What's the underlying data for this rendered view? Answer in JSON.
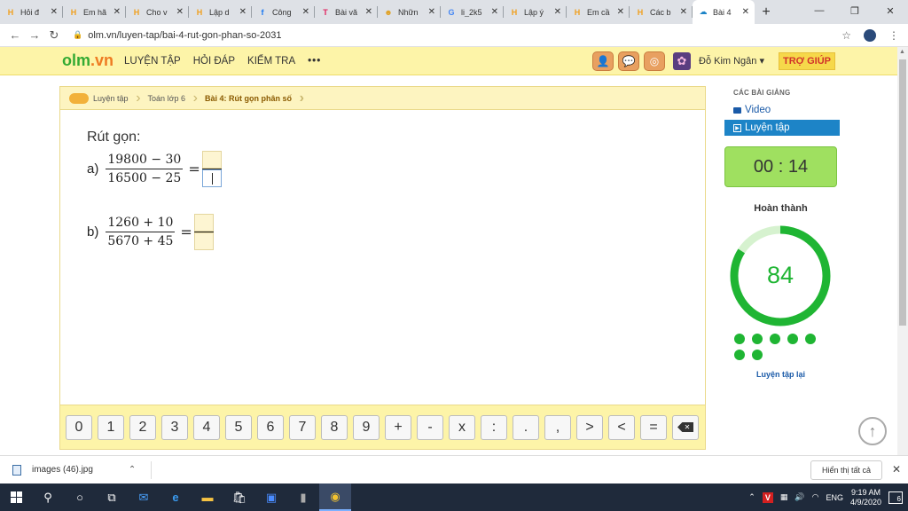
{
  "browser": {
    "tabs": [
      {
        "title": "Hỏi đ",
        "icon": "H",
        "color": "#f0a020"
      },
      {
        "title": "Em hã",
        "icon": "H",
        "color": "#f0a020"
      },
      {
        "title": "Cho v",
        "icon": "H",
        "color": "#f0a020"
      },
      {
        "title": "Lập d",
        "icon": "H",
        "color": "#f0a020"
      },
      {
        "title": "Công",
        "icon": "f",
        "color": "#1877f2"
      },
      {
        "title": "Bài vă",
        "icon": "T",
        "color": "#e0245e"
      },
      {
        "title": "Nhữn",
        "icon": "☻",
        "color": "#e0a020"
      },
      {
        "title": "li_2k5",
        "icon": "G",
        "color": "#4285f4"
      },
      {
        "title": "Lập ý",
        "icon": "H",
        "color": "#f0a020"
      },
      {
        "title": "Em cầ",
        "icon": "H",
        "color": "#f0a020"
      },
      {
        "title": "Các b",
        "icon": "H",
        "color": "#f0a020"
      },
      {
        "title": "Bài 4",
        "icon": "☁",
        "color": "#1d84c7",
        "active": true
      }
    ],
    "url": "olm.vn/luyen-tap/bai-4-rut-gon-phan-so-2031"
  },
  "header": {
    "logo_a": "olm",
    "logo_b": ".vn",
    "nav": [
      "LUYỆN TẬP",
      "HỎI ĐÁP",
      "KIỂM TRA"
    ],
    "more": "•••",
    "username": "Đỗ Kim Ngân",
    "help": "TRỢ GIÚP"
  },
  "breadcrumb": [
    "Luyện tập",
    "Toán lớp 6",
    "Bài 4: Rút gọn phân số"
  ],
  "question": {
    "title": "Rút gọn:",
    "a": {
      "label": "a)",
      "num": "19800 − 30",
      "den": "16500 − 25"
    },
    "b": {
      "label": "b)",
      "num": "1260 + 10",
      "den": "5670 + 45"
    },
    "eq": "="
  },
  "keypad": [
    "0",
    "1",
    "2",
    "3",
    "4",
    "5",
    "6",
    "7",
    "8",
    "9",
    "+",
    "-",
    "x",
    ":",
    ".",
    ",",
    ">",
    "<",
    "="
  ],
  "sidebar": {
    "header": "CÁC BÀI GIẢNG",
    "items": [
      "Video",
      "Luyện tập"
    ],
    "timer": "00 : 14",
    "done_label": "Hoàn thành",
    "score": "84",
    "score_percent": 84,
    "dots_count": 7,
    "retry": "Luyện tập lại",
    "colors": {
      "ring": "#1fb533",
      "ring_track": "#d6f2cf",
      "score": "#1fb533"
    }
  },
  "download": {
    "file": "images (46).jpg",
    "show_all": "Hiển thị tất cả"
  },
  "taskbar": {
    "time": "9:19 AM",
    "date": "4/9/2020",
    "lang": "ENG",
    "notif_count": "6"
  }
}
